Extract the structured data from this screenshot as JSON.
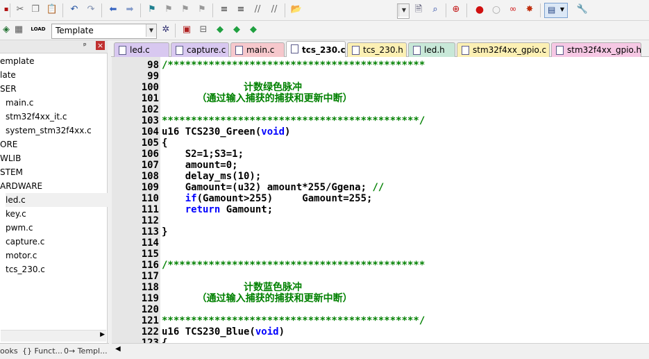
{
  "toolbar2": {
    "target_select": "Template"
  },
  "project": {
    "pin_glyph": "ᵖ",
    "close_glyph": "×",
    "items": [
      {
        "label": "emplate",
        "indent": 0
      },
      {
        "label": "late",
        "indent": 0
      },
      {
        "label": "SER",
        "indent": 0
      },
      {
        "label": "main.c",
        "indent": 1
      },
      {
        "label": "stm32f4xx_it.c",
        "indent": 1
      },
      {
        "label": "system_stm32f4xx.c",
        "indent": 1
      },
      {
        "label": "ORE",
        "indent": 0
      },
      {
        "label": "WLIB",
        "indent": 0
      },
      {
        "label": "STEM",
        "indent": 0
      },
      {
        "label": "ARDWARE",
        "indent": 0
      },
      {
        "label": "led.c",
        "indent": 1,
        "selected": true
      },
      {
        "label": "key.c",
        "indent": 1
      },
      {
        "label": "pwm.c",
        "indent": 1
      },
      {
        "label": "capture.c",
        "indent": 1
      },
      {
        "label": "motor.c",
        "indent": 1
      },
      {
        "label": "tcs_230.c",
        "indent": 1
      }
    ],
    "bottom_tabs": [
      "ooks",
      "{} Funct...",
      "0→ Templ..."
    ]
  },
  "file_tabs": [
    {
      "label": "led.c",
      "color": "#d8c8f0"
    },
    {
      "label": "capture.c",
      "color": "#d8c8f0"
    },
    {
      "label": "main.c",
      "color": "#f6c8cc"
    },
    {
      "label": "tcs_230.c",
      "color": "#ffffff",
      "active": true
    },
    {
      "label": "tcs_230.h",
      "color": "#fcf0b4"
    },
    {
      "label": "led.h",
      "color": "#c8e8d8"
    },
    {
      "label": "stm32f4xx_gpio.c",
      "color": "#fcf0b4"
    },
    {
      "label": "stm32f4xx_gpio.h",
      "color": "#f6c8e4"
    }
  ],
  "editor": {
    "lines": [
      {
        "n": "98",
        "parts": [
          {
            "t": "/********************************************",
            "c": "comment"
          }
        ]
      },
      {
        "n": "99",
        "parts": []
      },
      {
        "n": "100",
        "parts": [
          {
            "t": "              计数绿色脉冲",
            "c": "comment"
          }
        ]
      },
      {
        "n": "101",
        "parts": [
          {
            "t": "      （通过输入捕获的捕获和更新中断）",
            "c": "comment"
          }
        ]
      },
      {
        "n": "102",
        "parts": []
      },
      {
        "n": "103",
        "parts": [
          {
            "t": "********************************************/",
            "c": "comment"
          }
        ]
      },
      {
        "n": "104",
        "parts": [
          {
            "t": "u16 TCS230_Green(",
            "c": "plain"
          },
          {
            "t": "void",
            "c": "kw"
          },
          {
            "t": ")",
            "c": "plain"
          }
        ]
      },
      {
        "n": "105",
        "parts": [
          {
            "t": "{",
            "c": "plain"
          }
        ]
      },
      {
        "n": "106",
        "parts": [
          {
            "t": "    S2=1;S3=1;",
            "c": "plain"
          }
        ]
      },
      {
        "n": "107",
        "parts": [
          {
            "t": "    amount=0;",
            "c": "plain"
          }
        ]
      },
      {
        "n": "108",
        "parts": [
          {
            "t": "    delay_ms(10);",
            "c": "plain"
          }
        ]
      },
      {
        "n": "109",
        "parts": [
          {
            "t": "    Gamount=(u32) amount*255/Ggena; ",
            "c": "plain"
          },
          {
            "t": "//",
            "c": "comment"
          }
        ]
      },
      {
        "n": "110",
        "parts": [
          {
            "t": "    ",
            "c": "plain"
          },
          {
            "t": "if",
            "c": "kw"
          },
          {
            "t": "(Gamount>255)     Gamount=255;",
            "c": "plain"
          }
        ]
      },
      {
        "n": "111",
        "parts": [
          {
            "t": "    ",
            "c": "plain"
          },
          {
            "t": "return",
            "c": "kw"
          },
          {
            "t": " Gamount;",
            "c": "plain"
          }
        ]
      },
      {
        "n": "112",
        "parts": []
      },
      {
        "n": "113",
        "parts": [
          {
            "t": "}",
            "c": "plain"
          }
        ]
      },
      {
        "n": "114",
        "parts": []
      },
      {
        "n": "115",
        "parts": []
      },
      {
        "n": "116",
        "parts": [
          {
            "t": "/********************************************",
            "c": "comment"
          }
        ]
      },
      {
        "n": "117",
        "parts": []
      },
      {
        "n": "118",
        "parts": [
          {
            "t": "              计数蓝色脉冲",
            "c": "comment"
          }
        ]
      },
      {
        "n": "119",
        "parts": [
          {
            "t": "      （通过输入捕获的捕获和更新中断）",
            "c": "comment"
          }
        ]
      },
      {
        "n": "120",
        "parts": []
      },
      {
        "n": "121",
        "parts": [
          {
            "t": "********************************************/",
            "c": "comment"
          }
        ]
      },
      {
        "n": "122",
        "parts": [
          {
            "t": "u16 TCS230_Blue(",
            "c": "plain"
          },
          {
            "t": "void",
            "c": "kw"
          },
          {
            "t": ")",
            "c": "plain"
          }
        ]
      },
      {
        "n": "123",
        "parts": [
          {
            "t": "{",
            "c": "plain"
          }
        ]
      }
    ]
  },
  "icons": {
    "toolbar1": [
      "cut-icon",
      "copy-icon",
      "paste-icon",
      "undo-icon",
      "redo-icon",
      "back-icon",
      "forward-icon",
      "bookmark-icon",
      "prev-bookmark-icon",
      "next-bookmark-icon",
      "clear-bookmarks-icon",
      "indent-icon",
      "unindent-icon",
      "comment-icon",
      "uncomment-icon",
      "open-folder-icon",
      "find-in-files-icon",
      "find-icon",
      "debug-icon",
      "breakpoint-icon",
      "disable-breakpoint-icon",
      "kill-breakpoints-icon",
      "clear-breakpoints-icon",
      "window-layout-icon",
      "settings-icon"
    ],
    "toolbar2": [
      "compile-icon",
      "build-icon",
      "download-icon",
      "options-icon",
      "manage-components-icon",
      "pack-installer-icon",
      "env-icon",
      "select-packs-icon"
    ]
  }
}
